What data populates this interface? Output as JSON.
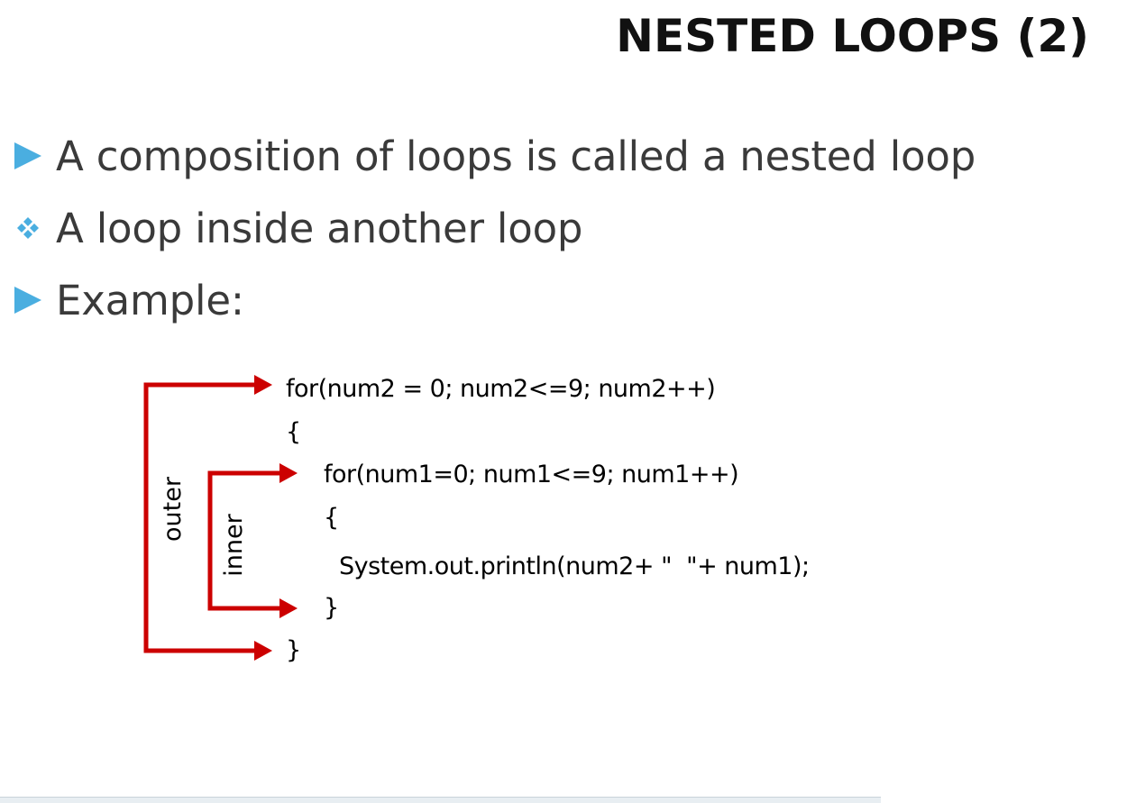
{
  "title": "NESTED LOOPS (2)",
  "bullets": [
    {
      "marker": "triangle-icon",
      "text": "A composition of loops is called a nested loop"
    },
    {
      "marker": "diamond-cluster-icon",
      "text": "A loop inside another loop"
    },
    {
      "marker": "triangle-icon",
      "text": "Example:"
    }
  ],
  "diagram": {
    "code": [
      "for(num2 = 0; num2<=9; num2++)",
      "{",
      "for(num1=0; num1<=9; num1++)",
      "{",
      "System.out.println(num2+ \"  \"+ num1);",
      "}",
      "}"
    ],
    "outer_label": "outer",
    "inner_label": "inner",
    "arrow_color": "#cc0000"
  },
  "colors": {
    "bullet_marker": "#4aaee0",
    "bullet_text": "#3a3a3a",
    "title": "#111111"
  }
}
